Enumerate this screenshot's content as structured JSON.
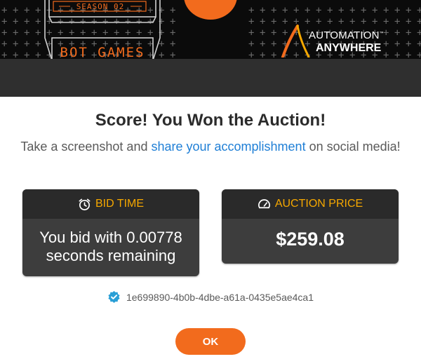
{
  "banner": {
    "season_text": "SEASON 02",
    "event_text": "BOT GAMES",
    "logo": {
      "line1": "AUTOMATION",
      "trademark": "™",
      "line2": "ANYWHERE"
    },
    "accent_color": "#f26b1d"
  },
  "modal": {
    "title": "Score! You Won the Auction!",
    "subtitle_prefix": "Take a screenshot and ",
    "subtitle_link": "share your accomplishment",
    "subtitle_suffix": " on social media!",
    "link_color": "#1f7fd6"
  },
  "bid_time": {
    "header_icon": "alarm-clock-icon",
    "header": "BID TIME",
    "line1": "You bid with 0.00778",
    "line2": "seconds remaining"
  },
  "auction_price": {
    "header_icon": "speedometer-icon",
    "header": "AUCTION PRICE",
    "value": "$259.08"
  },
  "transaction": {
    "icon": "verified-badge-icon",
    "id": "1e699890-4b0b-4dbe-a61a-0435e5ae4ca1"
  },
  "actions": {
    "ok_label": "OK"
  },
  "colors": {
    "header_label": "#f6a800",
    "card_bg": "#3d3d3d",
    "button": "#f26b1d"
  }
}
